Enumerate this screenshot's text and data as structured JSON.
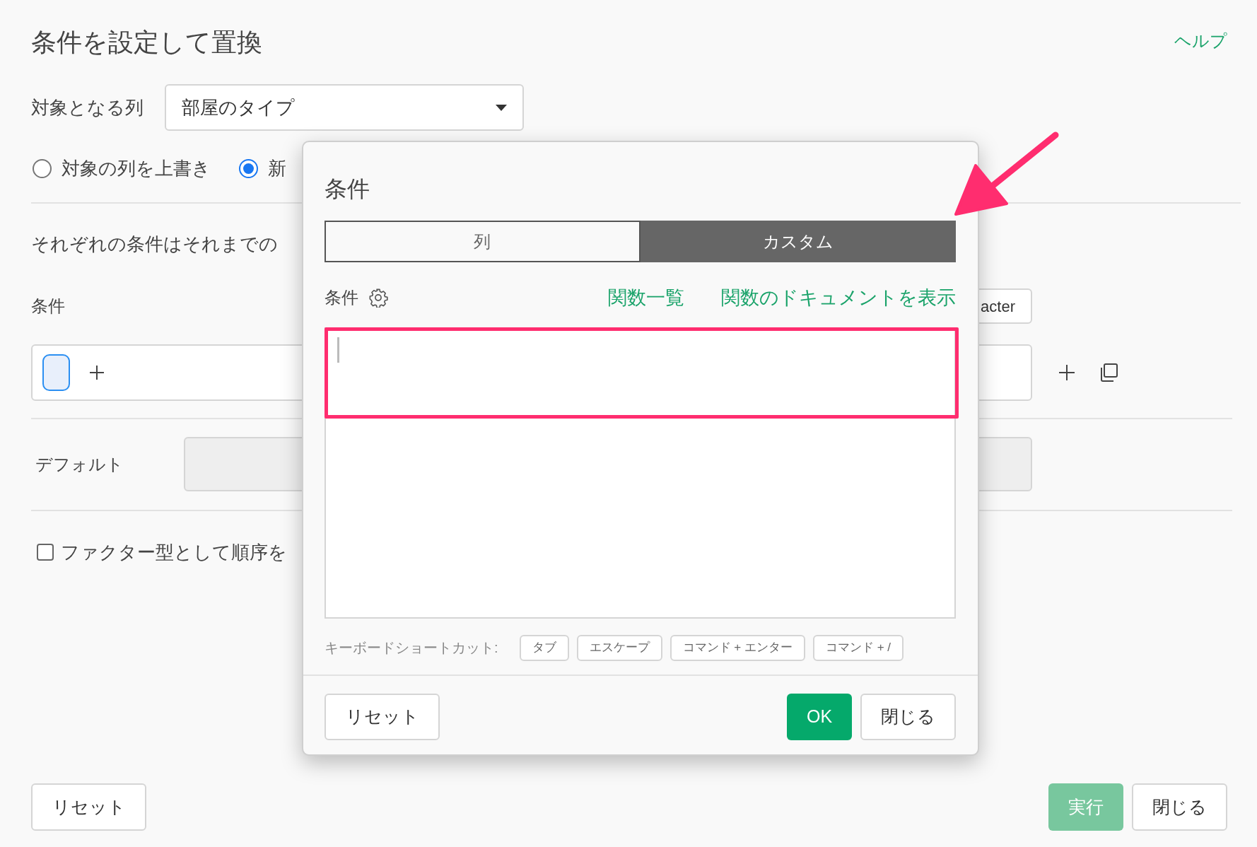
{
  "page": {
    "title": "条件を設定して置換",
    "help_link": "ヘルプ",
    "target_column": {
      "label": "対象となる列",
      "value": "部屋のタイプ"
    },
    "output_options": [
      {
        "label": "対象の列を上書き",
        "selected": false
      },
      {
        "label": "新",
        "selected": true
      }
    ],
    "description": "それぞれの条件はそれまでの",
    "condition": {
      "label": "条件",
      "type_button": "acter"
    },
    "default": {
      "label": "デフォルト"
    },
    "factor_option": {
      "label": "ファクター型として順序を",
      "checked": false
    },
    "reset_button": "リセット",
    "run_button": {
      "label": "実行",
      "disabled": true
    },
    "close_button": "閉じる"
  },
  "dialog": {
    "title": "条件",
    "tabs": [
      {
        "label": "列",
        "selected": false
      },
      {
        "label": "カスタム",
        "selected": true
      }
    ],
    "editor_label": "条件",
    "links": [
      "関数一覧",
      "関数のドキュメントを表示"
    ],
    "shortcuts": {
      "label": "キーボードショートカット:",
      "keys": [
        "タブ",
        "エスケープ",
        "コマンド + エンター",
        "コマンド + /"
      ]
    },
    "reset_button": "リセット",
    "ok_button": "OK",
    "close_button": "閉じる"
  }
}
